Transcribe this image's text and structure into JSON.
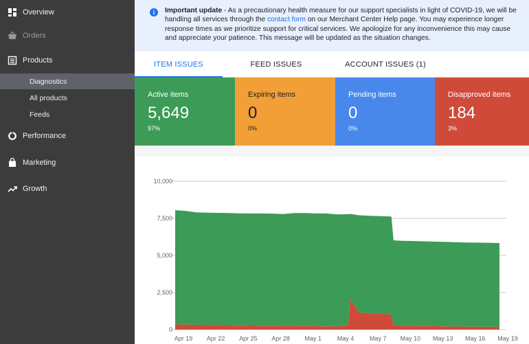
{
  "sidebar": {
    "overview": "Overview",
    "orders": "Orders",
    "products": "Products",
    "diagnostics": "Diagnostics",
    "all_products": "All products",
    "feeds": "Feeds",
    "performance": "Performance",
    "marketing": "Marketing",
    "growth": "Growth"
  },
  "banner": {
    "title": "Important update",
    "text_before_link": " - As a precautionary health measure for our support specialists in light of COVID-19, we will be handling all services through the ",
    "link_text": "contact form",
    "text_after_link": " on our Merchant Center Help page. You may experience longer response times as we prioritize support for critical services. We apologize for any inconvenience this may cause and appreciate your patience. This message will be updated as the situation changes."
  },
  "tabs": [
    {
      "label": "ITEM ISSUES",
      "active": true
    },
    {
      "label": "FEED ISSUES",
      "active": false
    },
    {
      "label": "ACCOUNT ISSUES (1)",
      "active": false
    }
  ],
  "tiles": [
    {
      "label": "Active items",
      "value": "5,649",
      "pct": "97%",
      "color": "#3c9b57"
    },
    {
      "label": "Expiring items",
      "value": "0",
      "pct": "0%",
      "color": "#f29f37"
    },
    {
      "label": "Pending items",
      "value": "0",
      "pct": "0%",
      "color": "#4888eb"
    },
    {
      "label": "Disapproved items",
      "value": "184",
      "pct": "3%",
      "color": "#d04a3a"
    }
  ],
  "chart_data": {
    "type": "area",
    "stacked": true,
    "x_tick_labels": [
      "Apr 19",
      "Apr 22",
      "Apr 25",
      "Apr 28",
      "May 1",
      "May 4",
      "May 7",
      "May 10",
      "May 13",
      "May 16",
      "May 19"
    ],
    "y_tick_labels": [
      "0",
      "2,500",
      "5,000",
      "7,500",
      "10,000"
    ],
    "ylim": [
      0,
      10000
    ],
    "x_days": [
      0,
      1,
      2,
      3,
      4,
      5,
      6,
      7,
      8,
      9,
      10,
      11,
      12,
      13,
      14,
      15,
      16,
      16.2,
      17,
      18,
      19,
      20,
      20.2,
      21,
      22,
      23,
      24,
      25,
      26,
      27,
      28,
      29,
      30
    ],
    "series": [
      {
        "color": "#d04a3a",
        "values": [
          350,
          340,
          330,
          320,
          310,
          300,
          290,
          280,
          270,
          270,
          260,
          250,
          240,
          230,
          220,
          210,
          300,
          2050,
          1150,
          1100,
          1060,
          1020,
          300,
          260,
          250,
          240,
          230,
          220,
          210,
          200,
          195,
          190,
          184
        ]
      },
      {
        "color": "#3c9b57",
        "values": [
          7700,
          7660,
          7570,
          7560,
          7560,
          7560,
          7550,
          7550,
          7560,
          7550,
          7530,
          7610,
          7620,
          7600,
          7610,
          7560,
          7480,
          5750,
          6560,
          6570,
          6590,
          6600,
          5720,
          5720,
          5720,
          5710,
          5700,
          5690,
          5680,
          5670,
          5665,
          5660,
          5649
        ]
      }
    ],
    "colors": {
      "active": "#3c9b57",
      "disapproved": "#d04a3a"
    }
  }
}
